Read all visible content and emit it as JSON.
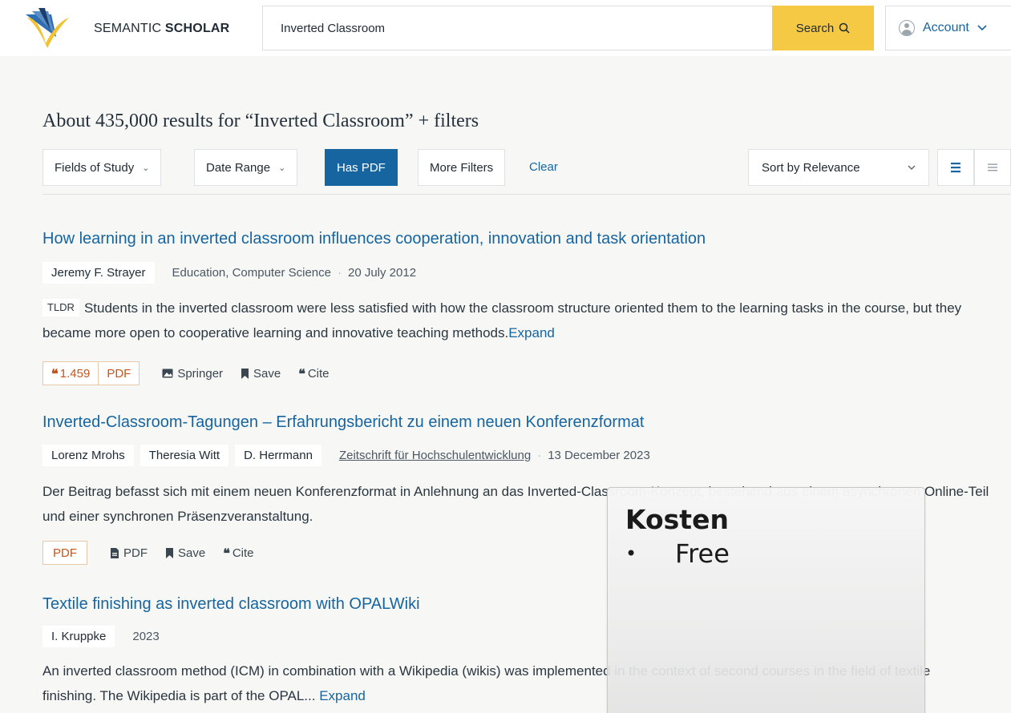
{
  "header": {
    "brand_regular": "SEMANTIC ",
    "brand_bold": "SCHOLAR",
    "search_value": "Inverted Classroom",
    "search_label": "Search",
    "account_label": "Account"
  },
  "results_heading": "About 435,000 results for “Inverted Classroom” + filters",
  "filters": {
    "fields_of_study": "Fields of Study",
    "date_range": "Date Range",
    "has_pdf": "Has PDF",
    "more_filters": "More Filters",
    "clear": "Clear",
    "sort": "Sort by Relevance"
  },
  "results": [
    {
      "title": "How learning in an inverted classroom influences cooperation, innovation and task orientation",
      "authors": [
        "Jeremy F. Strayer"
      ],
      "fields": "Education, Computer Science",
      "date": "20 July 2012",
      "tldr_label": "TLDR",
      "abstract": "Students in the inverted classroom were less satisfied with how the classroom structure oriented them to the learning tasks in the course, but they became more open to cooperative learning and innovative teaching methods.",
      "expand": "Expand",
      "citations": "1.459",
      "pdf_badge": "PDF",
      "source": "Springer",
      "save": "Save",
      "cite": "Cite"
    },
    {
      "title": "Inverted-Classroom-Tagungen – Erfahrungsbericht zu einem neuen Konferenzformat",
      "authors": [
        "Lorenz Mrohs",
        "Theresia Witt",
        "D. Herrmann"
      ],
      "venue": "Zeitschrift für Hochschulentwicklung",
      "date": "13 December 2023",
      "abstract": "Der Beitrag befasst sich mit einem neuen Konferenzformat in Anlehnung an das Inverted-Classroom-Konzept, bestehend aus einem asynchronen Online-Teil und einer synchronen Präsenzveranstaltung.",
      "pdf_badge": "PDF",
      "source": "PDF",
      "save": "Save",
      "cite": "Cite"
    },
    {
      "title": "Textile finishing as inverted classroom with OPALWiki",
      "authors": [
        "I. Kruppke"
      ],
      "date": "2023",
      "abstract": "An inverted classroom method (ICM) in combination with a Wikipedia (wikis) was implemented in the context of second courses in the field of textile finishing. The Wikipedia is part of the OPAL...",
      "expand": "Expand"
    }
  ],
  "overlay": {
    "title": "Kosten",
    "items": [
      "Free"
    ]
  },
  "colors": {
    "link": "#1665a0",
    "search_button": "#f5c944",
    "citation_accent": "#c4551b"
  }
}
